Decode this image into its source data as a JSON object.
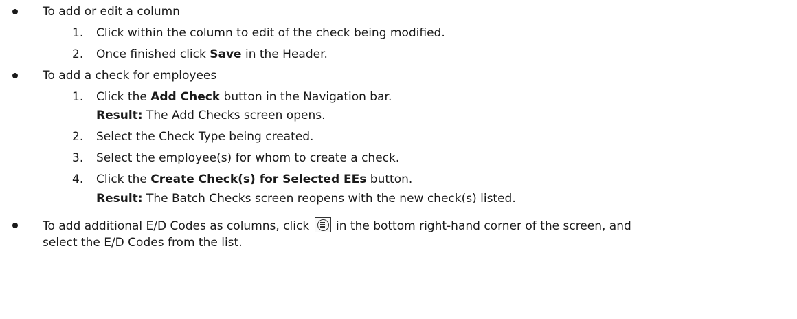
{
  "items": [
    {
      "text": "To add or edit a column",
      "steps": [
        {
          "num": "1.",
          "text": "Click within the column to edit of the check being modified."
        },
        {
          "num": "2.",
          "pre": "Once finished click ",
          "bold": "Save",
          "post": " in the Header."
        }
      ]
    },
    {
      "text": "To add a check for employees",
      "steps": [
        {
          "num": "1.",
          "pre": "Click the ",
          "bold": "Add Check",
          "post": " button in the Navigation bar."
        },
        {
          "result_label": "Result:",
          "result_text": " The Add Checks screen opens."
        },
        {
          "num": "2.",
          "text": "Select the Check Type being created."
        },
        {
          "num": "3.",
          "text": "Select the employee(s) for whom to create a check."
        },
        {
          "num": "4.",
          "pre": "Click the ",
          "bold": "Create Check(s) for Selected EEs",
          "post": " button."
        },
        {
          "result_label": "Result:",
          "result_text": " The Batch Checks screen reopens with the new check(s) listed."
        }
      ]
    },
    {
      "pre": "To add additional E/D Codes as columns, click ",
      "icon": "menu-list-icon",
      "post": " in the bottom right-hand corner of the screen, and",
      "continuation": "select the E/D Codes from the list."
    }
  ]
}
